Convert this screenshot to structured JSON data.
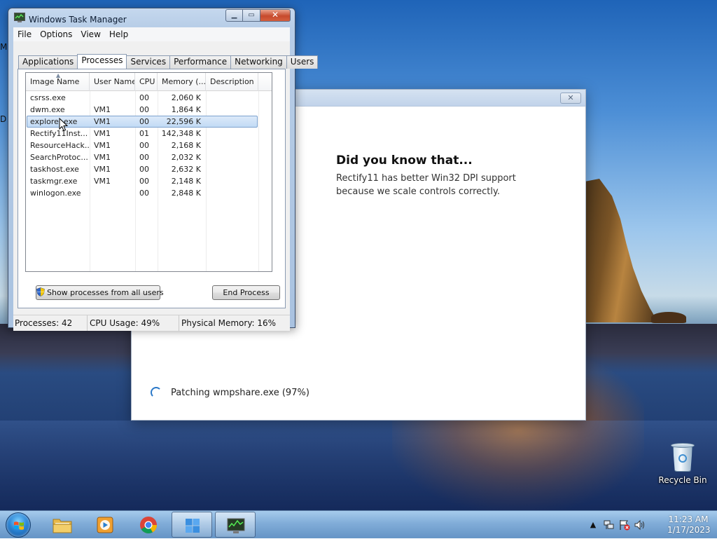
{
  "desktop": {
    "edge_labels": [
      "M",
      "D"
    ],
    "recycle_bin_label": "Recycle Bin"
  },
  "installer": {
    "close_glyph": "✕",
    "did_you_know_title": "Did you know that...",
    "did_you_know_text": "Rectify11 has better Win32 DPI support because we scale controls correctly.",
    "status_text": "Patching wmpshare.exe (97%)",
    "progress_percent": 97
  },
  "taskmgr": {
    "title": "Windows Task Manager",
    "caption": {
      "minimize": "▁",
      "maximize": "▭",
      "close": "✕"
    },
    "menu": [
      "File",
      "Options",
      "View",
      "Help"
    ],
    "tabs": [
      "Applications",
      "Processes",
      "Services",
      "Performance",
      "Networking",
      "Users"
    ],
    "active_tab": "Processes",
    "columns": [
      "Image Name",
      "User Name",
      "CPU",
      "Memory (...",
      "Description"
    ],
    "processes": [
      {
        "name": "csrss.exe",
        "user": "",
        "cpu": "00",
        "mem": "2,060 K",
        "desc": ""
      },
      {
        "name": "dwm.exe",
        "user": "VM1",
        "cpu": "00",
        "mem": "1,864 K",
        "desc": ""
      },
      {
        "name": "explorer.exe",
        "user": "VM1",
        "cpu": "00",
        "mem": "22,596 K",
        "desc": ""
      },
      {
        "name": "Rectify11Inst...",
        "user": "VM1",
        "cpu": "01",
        "mem": "142,348 K",
        "desc": ""
      },
      {
        "name": "ResourceHack...",
        "user": "VM1",
        "cpu": "00",
        "mem": "2,168 K",
        "desc": ""
      },
      {
        "name": "SearchProtoc...",
        "user": "VM1",
        "cpu": "00",
        "mem": "2,032 K",
        "desc": ""
      },
      {
        "name": "taskhost.exe",
        "user": "VM1",
        "cpu": "00",
        "mem": "2,632 K",
        "desc": ""
      },
      {
        "name": "taskmgr.exe",
        "user": "VM1",
        "cpu": "00",
        "mem": "2,148 K",
        "desc": ""
      },
      {
        "name": "winlogon.exe",
        "user": "",
        "cpu": "00",
        "mem": "2,848 K",
        "desc": ""
      }
    ],
    "selected_process": "explorer.exe",
    "show_all_label": "Show processes from all users",
    "end_process_label": "End Process",
    "status": {
      "processes": "Processes: 42",
      "cpu": "CPU Usage: 49%",
      "memory": "Physical Memory: 16%"
    }
  },
  "taskbar": {
    "pinned": [
      "start-button",
      "file-explorer",
      "media-player",
      "chrome",
      "rectify11-installer",
      "task-manager"
    ],
    "clock_time": "11:23 AM",
    "clock_date": "1/17/2023",
    "tray_expand": "▲"
  }
}
